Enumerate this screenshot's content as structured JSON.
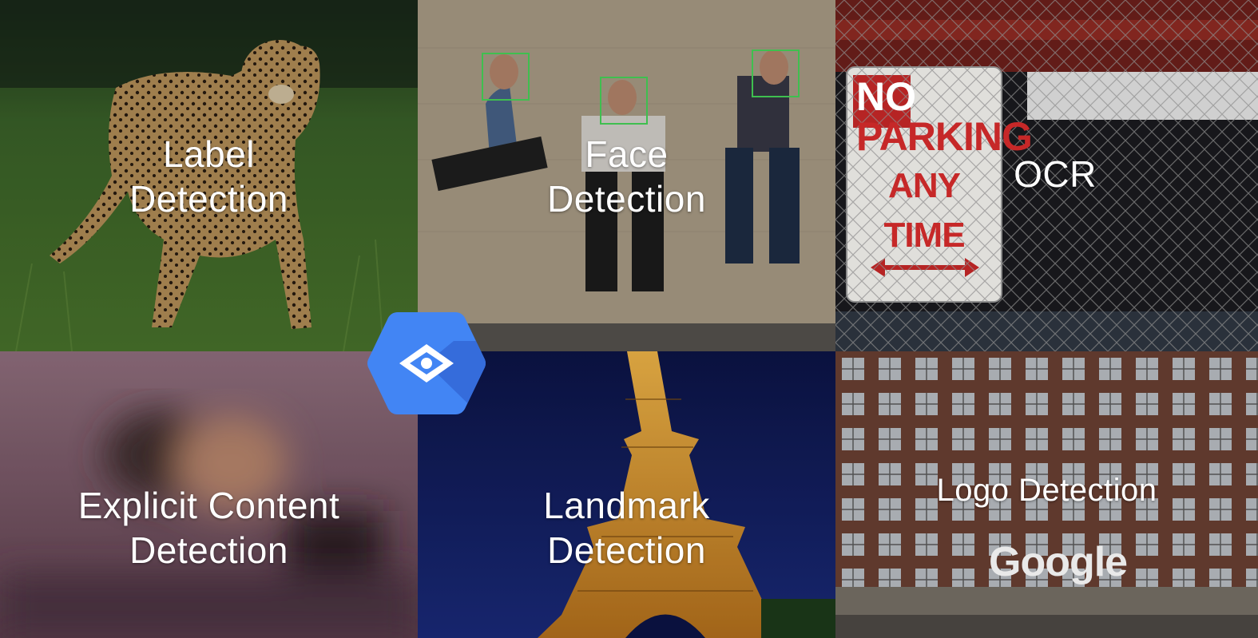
{
  "tiles": {
    "label": {
      "line1": "Label",
      "line2": "Detection"
    },
    "face": {
      "line1": "Face",
      "line2": "Detection"
    },
    "ocr": {
      "line1": "OCR"
    },
    "explicit": {
      "line1": "Explicit Content",
      "line2": "Detection"
    },
    "landmark": {
      "line1": "Landmark",
      "line2": "Detection"
    },
    "logo": {
      "line1": "Logo Detection"
    }
  },
  "sign": {
    "line1": "NO",
    "line2": "PARKING",
    "line3": "ANY TIME"
  },
  "logo_wordmark": "Google",
  "colors": {
    "vision_blue": "#4285f4",
    "vision_dark": "#3367d6",
    "face_box_green": "#3fbf4f",
    "sign_red": "#c62828"
  },
  "icons": [
    "cloud-vision-hexagon-icon",
    "eye-icon"
  ]
}
